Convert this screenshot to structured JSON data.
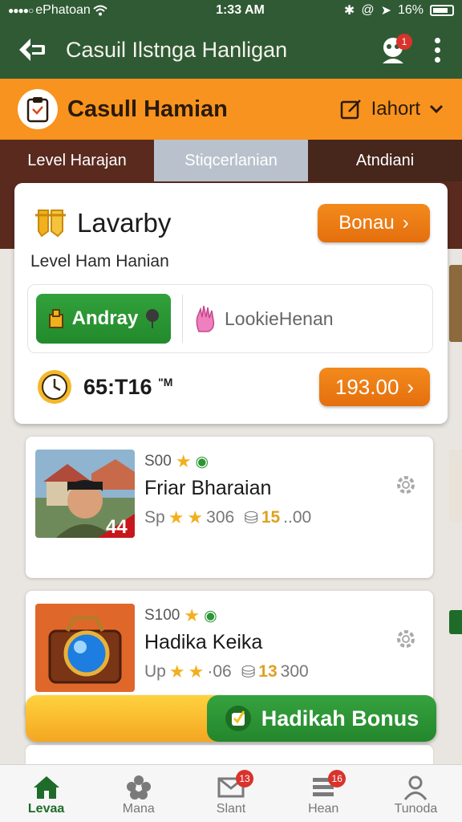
{
  "status_bar": {
    "carrier": "ePhatoan",
    "time": "1:33 AM",
    "battery": "16%"
  },
  "app_bar": {
    "title": "Casuil Ilstnga Hanligan",
    "notification_count": "1"
  },
  "header": {
    "brand": "Casull Hamian",
    "selector_label": "Iahort"
  },
  "tabs": [
    {
      "label": "Level Harajan"
    },
    {
      "label": "Stiqcerlanian"
    },
    {
      "label": "Atndiani"
    }
  ],
  "main_card": {
    "name": "Lavarby",
    "bonus_button": "Bonau",
    "subtitle": "Level Ham Hanian",
    "green_button": "Andray",
    "lookie_text": "LookieHenan",
    "timer": "65:T16",
    "timer_suffix": "\"M",
    "price_button": "193.00"
  },
  "items": [
    {
      "meta": "S00",
      "name": "Friar Bharaian",
      "prefix": "Sp",
      "count": "306",
      "highlight": "15",
      "value": "..00",
      "badge": "44"
    },
    {
      "meta": "S100",
      "name": "Hadika Keika",
      "prefix": "Up",
      "count": "·06",
      "highlight": "13",
      "value": "300"
    }
  ],
  "bonus_bar": {
    "label": "Hadikah Bonus"
  },
  "bottom_nav": [
    {
      "label": "Levaa",
      "badge": ""
    },
    {
      "label": "Mana",
      "badge": ""
    },
    {
      "label": "Slant",
      "badge": "13"
    },
    {
      "label": "Hean",
      "badge": "16"
    },
    {
      "label": "Tunoda",
      "badge": ""
    }
  ],
  "colors": {
    "green": "#2f5a34",
    "orange": "#f7931e",
    "button_green": "#2a9634",
    "button_orange": "#ea7a14"
  }
}
